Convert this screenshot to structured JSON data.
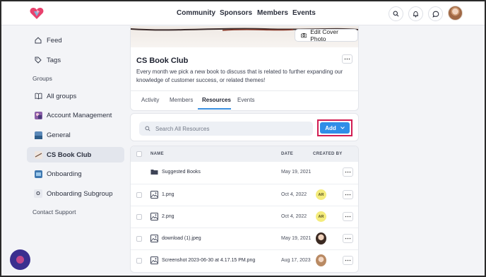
{
  "topnav": {
    "items": [
      "Community",
      "Sponsors",
      "Members",
      "Events"
    ]
  },
  "sidebar": {
    "items": [
      {
        "label": "Feed",
        "icon": "home-icon"
      },
      {
        "label": "Tags",
        "icon": "tag-icon"
      }
    ],
    "groups_heading": "Groups",
    "groups": [
      {
        "label": "All groups",
        "icon": "book-icon"
      },
      {
        "label": "Account Management",
        "icon": "group-thumbnail"
      },
      {
        "label": "General",
        "icon": "group-thumbnail"
      },
      {
        "label": "CS Book Club",
        "icon": "group-thumbnail",
        "active": true
      },
      {
        "label": "Onboarding",
        "icon": "group-thumbnail"
      },
      {
        "label": "Onboarding Subgroup",
        "icon": "letter-o-badge",
        "badge": "O"
      }
    ],
    "contact_support": "Contact Support"
  },
  "group": {
    "edit_cover_label": "Edit Cover Photo",
    "title": "CS Book Club",
    "description": "Every month we pick a new book to discuss that is related to further expanding our knowledge of customer success, or related themes!",
    "tabs": [
      "Activity",
      "Members",
      "Resources",
      "Events"
    ],
    "active_tab": "Resources"
  },
  "resources": {
    "search_placeholder": "Search All Resources",
    "add_label": "Add",
    "columns": {
      "name": "NAME",
      "date": "DATE",
      "created_by": "CREATED BY"
    },
    "rows": [
      {
        "name": "Suggested Books",
        "type": "folder",
        "date": "May 19, 2021",
        "creator": ""
      },
      {
        "name": "1.png",
        "type": "image",
        "date": "Oct 4, 2022",
        "creator": "AR"
      },
      {
        "name": "2.png",
        "type": "image",
        "date": "Oct 4, 2022",
        "creator": "AR"
      },
      {
        "name": "download (1).jpeg",
        "type": "image",
        "date": "May 19, 2021",
        "creator": "avatar"
      },
      {
        "name": "Screenshot 2023-06-30 at 4.17.15 PM.png",
        "type": "image",
        "date": "Aug 17, 2023",
        "creator": "avatar"
      }
    ]
  },
  "colors": {
    "accent": "#2f8ee8",
    "highlight_border": "#d21d52",
    "chip_yellow": "#f4ec7c",
    "fab": "#3b2f8f"
  }
}
